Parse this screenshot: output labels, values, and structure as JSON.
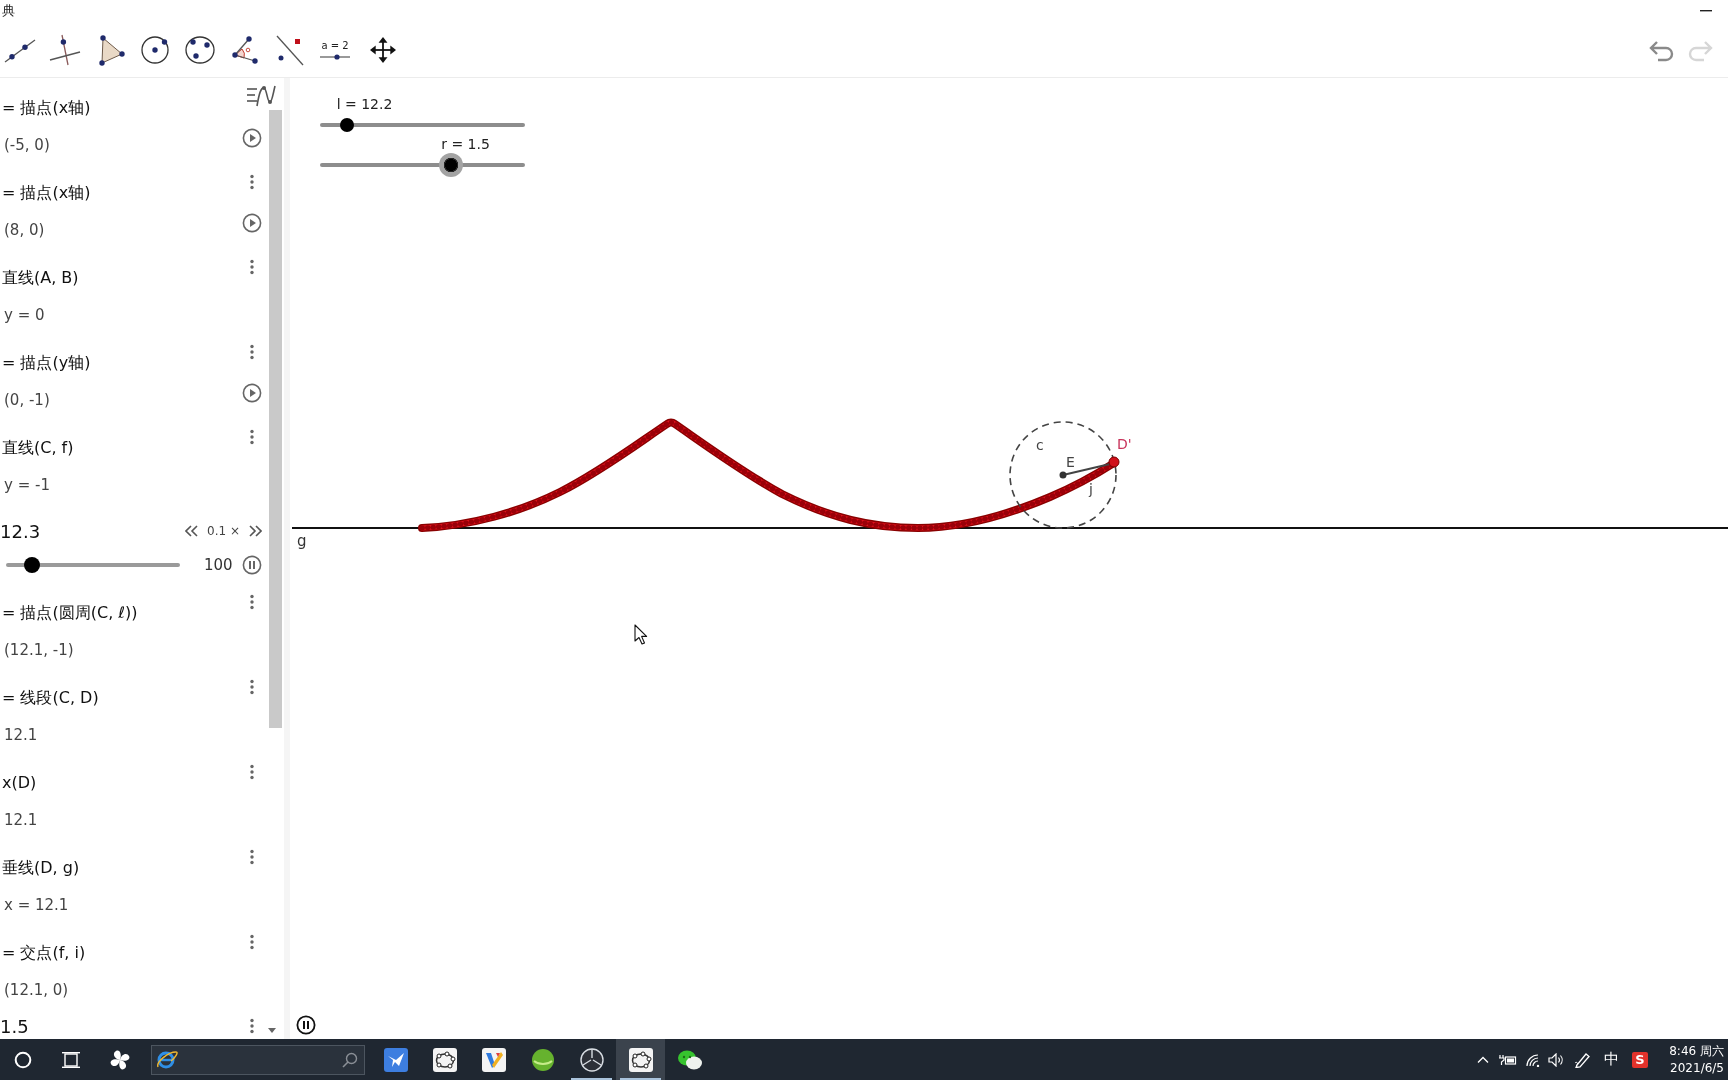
{
  "window": {
    "title": "典"
  },
  "toolbar": {
    "tools": [
      {
        "kind": "line"
      },
      {
        "kind": "perpendicular"
      },
      {
        "kind": "polygon"
      },
      {
        "kind": "circle_center"
      },
      {
        "kind": "circle_three_points"
      },
      {
        "kind": "angle"
      },
      {
        "kind": "reflect"
      },
      {
        "kind": "slider",
        "label": "a = 2"
      },
      {
        "kind": "move"
      }
    ],
    "undo": {
      "disabled": false
    },
    "redo": {
      "disabled": true
    }
  },
  "algebra_view": {
    "items": [
      {
        "kind": "expression",
        "definition": "= 描点(x轴)",
        "value": "(-5, 0)",
        "menu_button": false,
        "playing": false
      },
      {
        "kind": "expression",
        "definition": "= 描点(x轴)",
        "value": "(8, 0)",
        "menu_button": true,
        "playing": false
      },
      {
        "kind": "expression",
        "definition": "直线(A, B)",
        "value": "y = 0",
        "menu_button": true
      },
      {
        "kind": "expression",
        "definition": "= 描点(y轴)",
        "value": "(0, -1)",
        "menu_button": true,
        "playing": false
      },
      {
        "kind": "expression",
        "definition": "直线(C, f)",
        "value": "y = -1",
        "menu_button": true
      },
      {
        "kind": "slider",
        "value": "12.3",
        "speed": "0.1 ×",
        "max": "100",
        "level": 0.15,
        "menu_button": false,
        "playing": true
      },
      {
        "kind": "expression",
        "definition": "= 描点(圆周(C, ℓ))",
        "value": "(12.1, -1)",
        "menu_button": true
      },
      {
        "kind": "expression",
        "definition": "= 线段(C, D)",
        "value": "12.1",
        "menu_button": true
      },
      {
        "kind": "expression",
        "definition": "x(D)",
        "value": "12.1",
        "menu_button": true
      },
      {
        "kind": "expression",
        "definition": "垂线(D, g)",
        "value": "x = 12.1",
        "menu_button": true
      },
      {
        "kind": "expression",
        "definition": "= 交点(f, i)",
        "value": "(12.1, 0)",
        "menu_button": true
      },
      {
        "kind": "number",
        "value": "1.5",
        "menu_button": true
      }
    ]
  },
  "graphics_view": {
    "sliders": [
      {
        "label": "l = 12.2",
        "level": 0.13,
        "highlighted": false
      },
      {
        "label": "r = 1.5",
        "level": 0.64,
        "highlighted": true
      }
    ],
    "line_label": "g",
    "circle_label": "c",
    "center_label": "E",
    "tracer_label": "D'",
    "segment_label": "j",
    "playing": true
  },
  "taskbar": {
    "apps": [
      {
        "kind": "bird",
        "running": false,
        "selected": false
      },
      {
        "kind": "geogebra",
        "running": false,
        "selected": false
      },
      {
        "kind": "tiles",
        "running": false,
        "selected": false
      },
      {
        "kind": "sphere",
        "running": false,
        "selected": false
      },
      {
        "kind": "aperture",
        "running": true,
        "selected": false
      },
      {
        "kind": "geogebra",
        "running": true,
        "selected": true
      },
      {
        "kind": "chat",
        "running": false,
        "selected": false
      }
    ],
    "tray": {
      "input_mode": "中",
      "ime_logo": "S"
    },
    "clock": {
      "time": "8:46 周六",
      "date": "2021/6/5"
    }
  }
}
